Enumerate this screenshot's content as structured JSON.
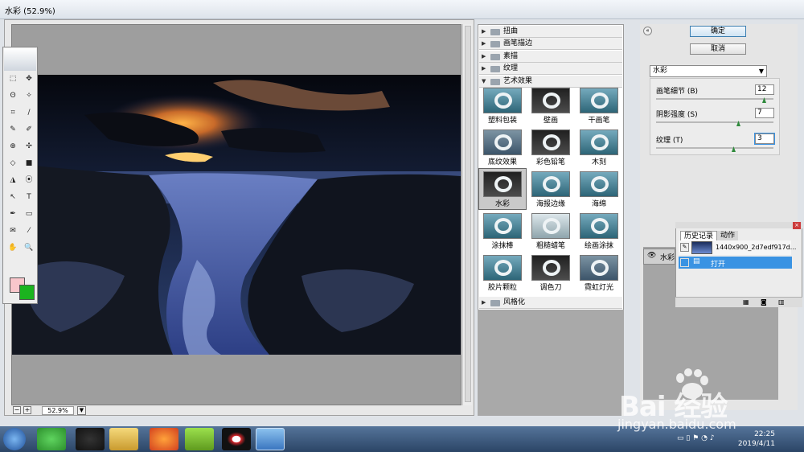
{
  "window": {
    "title": "水彩 (52.9%)"
  },
  "preview": {
    "zoom": "52.9%",
    "zoom_minus": "−",
    "zoom_plus": "+"
  },
  "buttons": {
    "ok": "确定",
    "cancel": "取消"
  },
  "filter_select": {
    "value": "水彩",
    "arrow": "▼"
  },
  "params": [
    {
      "label": "画笔细节 (B)",
      "value": "12",
      "slider_fraction": 0.92
    },
    {
      "label": "阴影强度 (S)",
      "value": "7",
      "slider_fraction": 0.7
    },
    {
      "label": "纹理 (T)",
      "value": "3",
      "slider_fraction": 0.66
    }
  ],
  "categories_top": [
    {
      "label": "扭曲",
      "tri": "▶"
    },
    {
      "label": "画笔描边",
      "tri": "▶"
    },
    {
      "label": "素描",
      "tri": "▶"
    },
    {
      "label": "纹理",
      "tri": "▶"
    },
    {
      "label": "艺术效果",
      "tri": "▼"
    }
  ],
  "category_bottom": {
    "label": "风格化",
    "tri": "▶"
  },
  "filters": [
    {
      "label": "塑料包装",
      "style": "teal"
    },
    {
      "label": "壁画",
      "style": "dark"
    },
    {
      "label": "干画笔",
      "style": "teal"
    },
    {
      "label": "底纹效果",
      "style": "blue"
    },
    {
      "label": "彩色铅笔",
      "style": "dark"
    },
    {
      "label": "木刻",
      "style": "teal"
    },
    {
      "label": "水彩",
      "style": "dark",
      "selected": true
    },
    {
      "label": "海报边缘",
      "style": "teal"
    },
    {
      "label": "海绵",
      "style": "teal"
    },
    {
      "label": "涂抹棒",
      "style": "teal"
    },
    {
      "label": "粗糙蜡笔",
      "style": "light"
    },
    {
      "label": "绘画涂抹",
      "style": "teal"
    },
    {
      "label": "胶片颗粒",
      "style": "teal"
    },
    {
      "label": "调色刀",
      "style": "dark"
    },
    {
      "label": "霓虹灯光",
      "style": "blue"
    }
  ],
  "layer": {
    "name": "水彩"
  },
  "history": {
    "tab_history": "历史记录",
    "tab_actions": "动作",
    "snapshot": "1440x900_2d7edf917d...",
    "step": "打开",
    "close": "×"
  },
  "toolbox": {
    "tools": [
      "⬚",
      "✥",
      "ʘ",
      "✧",
      "⌗",
      "∕",
      "✎",
      "✐",
      "⊕",
      "✣",
      "◇",
      "■",
      "◮",
      "⦿",
      "↖",
      "T",
      "✒",
      "▭",
      "✉",
      "⁄",
      "✋",
      "🔍"
    ],
    "color_fg": "#f9c6cb",
    "color_bg": "#1bb41f"
  },
  "taskbar": {
    "time": "22:25",
    "date": "2019/4/11"
  },
  "watermark": {
    "brand": "Bai  经验",
    "url": "jingyan.baidu.com"
  }
}
